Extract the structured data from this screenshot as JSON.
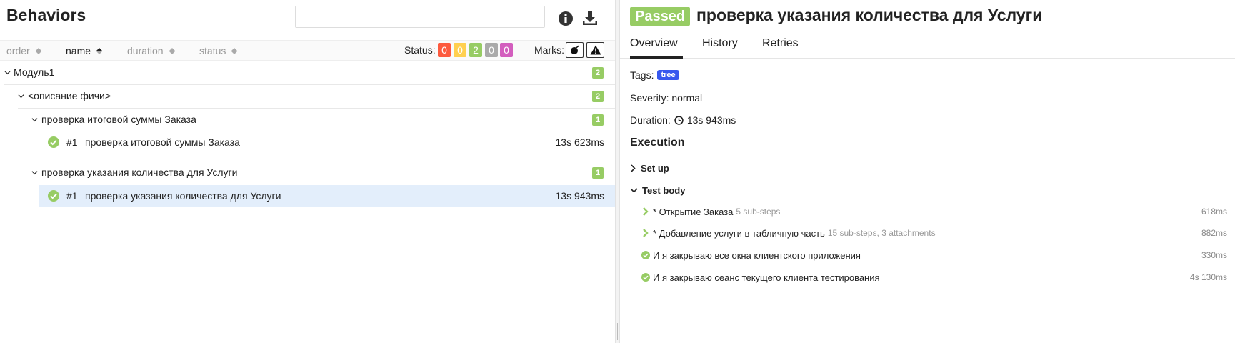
{
  "left": {
    "title": "Behaviors",
    "search": {
      "value": "",
      "placeholder": ""
    },
    "sort": [
      {
        "label": "order"
      },
      {
        "label": "name"
      },
      {
        "label": "duration"
      },
      {
        "label": "status"
      }
    ],
    "status_label": "Status:",
    "status_counts": [
      {
        "value": "0",
        "color": "#fd5a3e"
      },
      {
        "value": "0",
        "color": "#ffd050"
      },
      {
        "value": "2",
        "color": "#97cc64"
      },
      {
        "value": "0",
        "color": "#aaaaaa"
      },
      {
        "value": "0",
        "color": "#d35ebe"
      }
    ],
    "marks_label": "Marks:",
    "tree": {
      "module": {
        "label": "Модуль1",
        "count": "2"
      },
      "feature": {
        "label": "<описание фичи>",
        "count": "2"
      },
      "groups": [
        {
          "label": "проверка итоговой суммы Заказа",
          "count": "1",
          "case": {
            "num": "#1",
            "name": "проверка итоговой суммы Заказа",
            "duration": "13s 623ms"
          }
        },
        {
          "label": "проверка указания количества для Услуги",
          "count": "1",
          "case": {
            "num": "#1",
            "name": "проверка указания количества для Услуги",
            "duration": "13s 943ms"
          }
        }
      ]
    }
  },
  "right": {
    "status": "Passed",
    "title": "проверка указания количества для Услуги",
    "tabs": [
      "Overview",
      "History",
      "Retries"
    ],
    "tags_label": "Tags:",
    "tag": "tree",
    "severity": "Severity: normal",
    "duration_label": "Duration:",
    "duration": "13s 943ms",
    "execution_heading": "Execution",
    "setup_label": "Set up",
    "testbody_label": "Test body",
    "steps": [
      {
        "name": "* Открытие Заказа",
        "sub": "5 sub-steps",
        "duration": "618ms"
      },
      {
        "name": "* Добавление услуги в табличную часть",
        "sub": "15 sub-steps, 3 attachments",
        "duration": "882ms"
      },
      {
        "name": "И я закрываю все окна клиентского приложения",
        "sub": "",
        "duration": "330ms"
      },
      {
        "name": "И я закрываю сеанс текущего клиента тестирования",
        "sub": "",
        "duration": "4s 130ms"
      }
    ]
  },
  "colors": {
    "passed": "#97cc64",
    "tag": "#3758ee",
    "selected_row": "#e3eefb"
  },
  "icons": [
    "info-icon",
    "download-icon",
    "bomb-icon",
    "warning-icon",
    "check-icon",
    "chevron-right-icon",
    "chevron-down-icon",
    "clock-icon"
  ]
}
